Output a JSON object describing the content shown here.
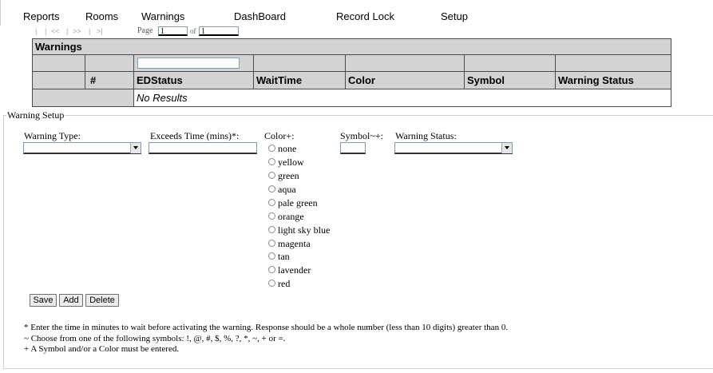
{
  "menu": {
    "items": [
      "Reports",
      "Rooms",
      "Warnings",
      "DashBoard",
      "Record Lock",
      "Setup"
    ]
  },
  "pager": {
    "first": "|<",
    "prev": "<<",
    "next": ">>",
    "last": ">|",
    "page_label": "Page",
    "page_value": "1",
    "of_label": "of",
    "of_value": "1"
  },
  "grid": {
    "title": "Warnings",
    "columns": [
      "",
      "#",
      "EDStatus",
      "WaitTime",
      "Color",
      "Symbol",
      "Warning Status"
    ],
    "no_results": "No Results"
  },
  "form": {
    "legend": "Warning Setup",
    "warning_type_label": "Warning Type:",
    "exceeds_label": "Exceeds Time (mins)*:",
    "color_label": "Color+:",
    "symbol_label": "Symbol~+:",
    "warning_status_label": "Warning Status:",
    "colors": [
      "none",
      "yellow",
      "green",
      "aqua",
      "pale green",
      "orange",
      "light sky blue",
      "magenta",
      "tan",
      "lavender",
      "red"
    ],
    "buttons": {
      "save": "Save",
      "add": "Add",
      "delete": "Delete"
    }
  },
  "notes": {
    "line1": "* Enter the time in minutes to wait before activating the warning. Response should be a whole number (less than 10 digits) greater than 0.",
    "line2": "~ Choose from one of the following symbols: !, @, #, $, %, ?, *, ~, + or =.",
    "line3": "+ A Symbol and/or a Color must be entered."
  }
}
